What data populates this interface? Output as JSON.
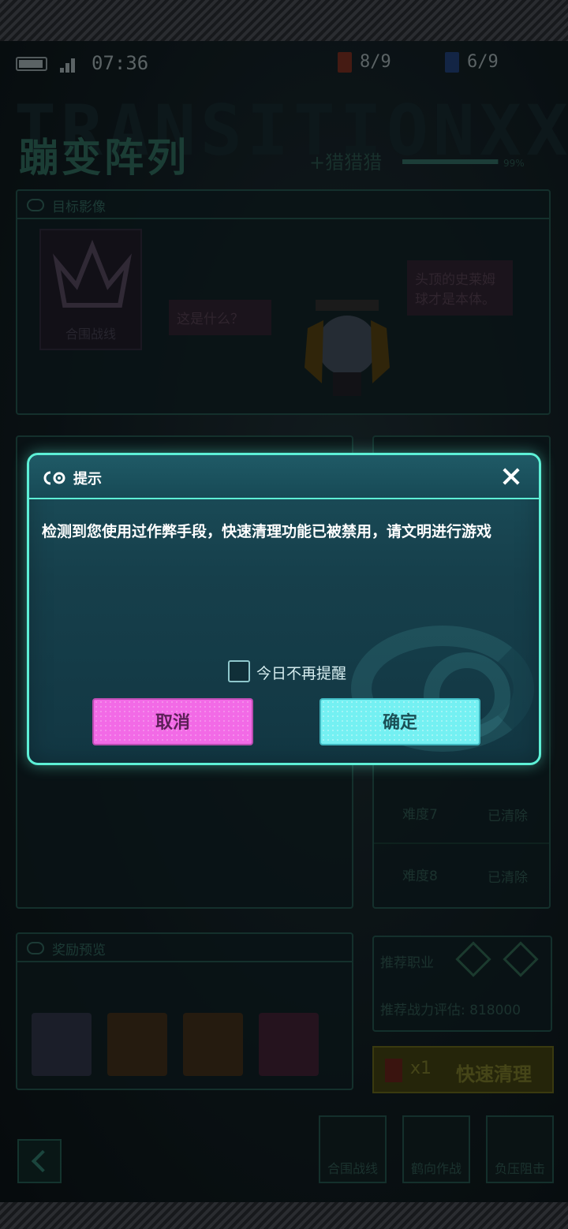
{
  "status_bar": {
    "time": "07:36",
    "resource_a": "8/9",
    "resource_b": "6/9"
  },
  "header": {
    "background_word": "TRANSITIONXXX",
    "title": "蹦变阵列",
    "subtitle": "+猎猎猎",
    "progress_pct": "99%",
    "progress_value": 0.99
  },
  "target_panel": {
    "label": "目标影像",
    "crest_label": "合围战线",
    "bubble_left": "这是什么？",
    "bubble_right": "头顶的史莱姆球才是本体。"
  },
  "difficulty_list": [
    {
      "name": "难度7",
      "state": "已清除"
    },
    {
      "name": "难度8",
      "state": "已清除"
    }
  ],
  "reward_panel": {
    "label": "奖励预览"
  },
  "recommend": {
    "class_label": "推荐职业",
    "power_label": "推荐战力评估:",
    "power_value": "818000"
  },
  "quick_clear": {
    "count": "x1",
    "label": "快速清理"
  },
  "bottom_nav": [
    {
      "label": "合围战线"
    },
    {
      "label": "鹤向作战"
    },
    {
      "label": "负压阻击"
    }
  ],
  "dialog": {
    "title": "提示",
    "message": "检测到您使用过作弊手段，快速清理功能已被禁用，请文明进行游戏",
    "checkbox_label": "今日不再提醒",
    "checkbox_checked": false,
    "cancel_label": "取消",
    "confirm_label": "确定"
  },
  "colors": {
    "dialog_border": "#5df0d6",
    "cancel_button": "#f26ae6",
    "confirm_button": "#74f0f2",
    "quick_clear": "#3a3a10"
  }
}
